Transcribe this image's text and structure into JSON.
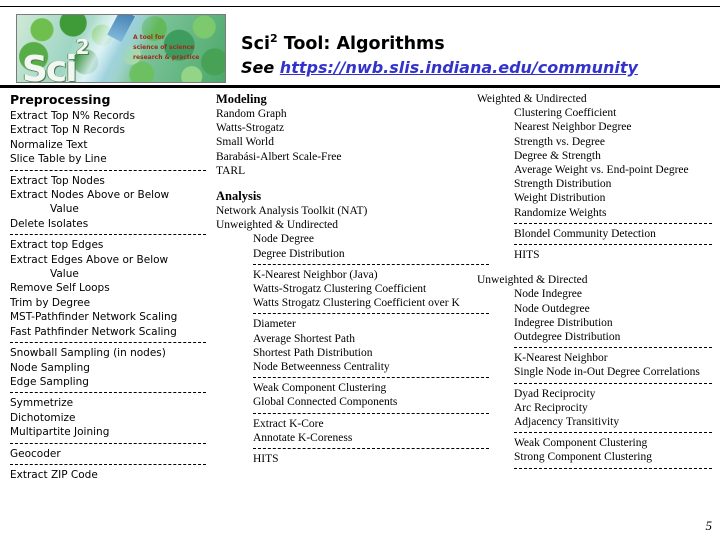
{
  "header": {
    "title_main": "Sci",
    "title_sup": "2",
    "title_rest": " Tool: Algorithms",
    "see_label": "See ",
    "url": "https://nwb.slis.indiana.edu/community",
    "logo": {
      "wordmark": "Sci",
      "wordmark_sup": "2",
      "tagline_line1": "A tool for",
      "tagline_line2": "science of science",
      "tagline_line3": "research & practice"
    },
    "link_color": "#3333cc"
  },
  "page_number": "5",
  "columns": {
    "preprocessing": {
      "heading": "Preprocessing",
      "groups": [
        {
          "items": [
            {
              "text": "Extract Top N% Records"
            },
            {
              "text": "Extract Top N Records"
            },
            {
              "text": "Normalize Text"
            },
            {
              "text": "Slice Table by Line"
            }
          ]
        },
        {
          "items": [
            {
              "text": "Extract Top Nodes"
            },
            {
              "text": "Extract Nodes Above or Below",
              "cont": "Value"
            },
            {
              "text": "Delete Isolates"
            }
          ]
        },
        {
          "items": [
            {
              "text": "Extract top Edges"
            },
            {
              "text": "Extract Edges Above or Below",
              "cont": "Value"
            },
            {
              "text": "Remove Self Loops"
            },
            {
              "text": "Trim by Degree"
            },
            {
              "text": "MST-Pathfinder Network Scaling"
            },
            {
              "text": "Fast Pathfinder Network Scaling"
            }
          ]
        },
        {
          "items": [
            {
              "text": "Snowball Sampling (in nodes)"
            },
            {
              "text": "Node Sampling"
            },
            {
              "text": "Edge Sampling"
            }
          ]
        },
        {
          "items": [
            {
              "text": "Symmetrize"
            },
            {
              "text": "Dichotomize"
            },
            {
              "text": "Multipartite Joining"
            }
          ]
        },
        {
          "items": [
            {
              "text": "Geocoder"
            }
          ]
        },
        {
          "items": [
            {
              "text": "Extract ZIP Code"
            }
          ]
        }
      ]
    },
    "modeling": {
      "heading": "Modeling",
      "items": [
        {
          "text": "Random Graph"
        },
        {
          "text": "Watts-Strogatz"
        },
        {
          "text": "Small World"
        },
        {
          "text": "Barabási-Albert Scale-Free"
        },
        {
          "text": "TARL"
        }
      ]
    },
    "analysis": {
      "heading": "Analysis",
      "top_items": [
        {
          "text": "Network Analysis Toolkit (NAT)"
        },
        {
          "text": "Unweighted & Undirected"
        }
      ],
      "groups": [
        {
          "items": [
            {
              "text": "Node Degree"
            },
            {
              "text": "Degree Distribution"
            }
          ]
        },
        {
          "items": [
            {
              "text": "K-Nearest Neighbor (Java)"
            },
            {
              "text": "Watts-Strogatz Clustering Coefficient"
            },
            {
              "text": "Watts Strogatz Clustering Coefficient over K"
            }
          ]
        },
        {
          "items": [
            {
              "text": "Diameter"
            },
            {
              "text": "Average Shortest Path"
            },
            {
              "text": "Shortest Path Distribution"
            },
            {
              "text": "Node Betweenness Centrality"
            }
          ]
        },
        {
          "items": [
            {
              "text": "Weak Component Clustering"
            },
            {
              "text": "Global Connected Components"
            }
          ]
        },
        {
          "items": [
            {
              "text": "Extract K-Core"
            },
            {
              "text": "Annotate K-Coreness"
            }
          ]
        },
        {
          "items": [
            {
              "text": "HITS"
            }
          ]
        }
      ]
    },
    "weighted_undirected": {
      "heading": "Weighted & Undirected",
      "groups": [
        {
          "items": [
            {
              "text": "Clustering Coefficient"
            },
            {
              "text": "Nearest Neighbor Degree"
            },
            {
              "text": "Strength vs. Degree"
            },
            {
              "text": "Degree & Strength"
            },
            {
              "text": "Average Weight vs. End-point Degree"
            },
            {
              "text": "Strength Distribution"
            },
            {
              "text": "Weight Distribution"
            },
            {
              "text": "Randomize Weights"
            }
          ]
        },
        {
          "items": [
            {
              "text": "Blondel Community Detection"
            }
          ]
        },
        {
          "items": [
            {
              "text": "HITS"
            }
          ]
        }
      ]
    },
    "unweighted_directed": {
      "heading": "Unweighted & Directed",
      "groups": [
        {
          "items": [
            {
              "text": "Node Indegree"
            },
            {
              "text": "Node Outdegree"
            },
            {
              "text": "Indegree Distribution"
            },
            {
              "text": "Outdegree Distribution"
            }
          ]
        },
        {
          "items": [
            {
              "text": "K-Nearest Neighbor"
            },
            {
              "text": "Single Node in-Out Degree Correlations"
            }
          ]
        },
        {
          "items": [
            {
              "text": "Dyad Reciprocity"
            },
            {
              "text": "Arc Reciprocity"
            },
            {
              "text": "Adjacency Transitivity"
            }
          ]
        },
        {
          "items": [
            {
              "text": "Weak Component Clustering"
            },
            {
              "text": "Strong Component Clustering"
            }
          ]
        }
      ],
      "trailing_divider": true
    }
  }
}
